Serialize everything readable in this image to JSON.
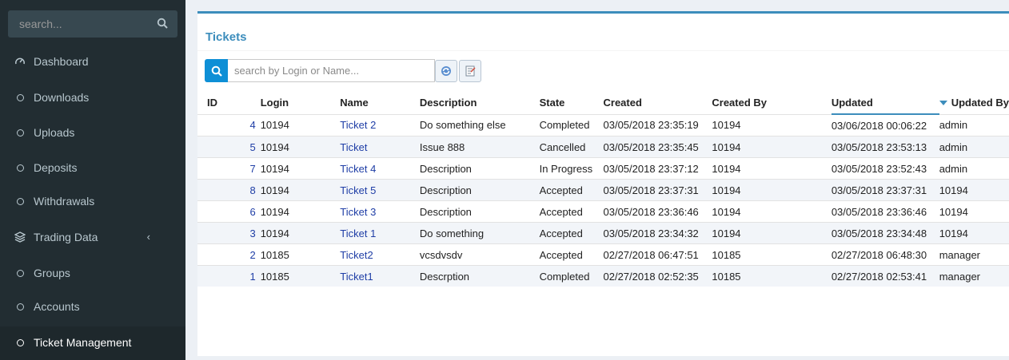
{
  "sidebar": {
    "search_placeholder": "search...",
    "items": [
      {
        "label": "Dashboard",
        "icon": "dashboard-icon"
      },
      {
        "label": "Downloads",
        "icon": "circle-icon"
      },
      {
        "label": "Uploads",
        "icon": "circle-icon"
      },
      {
        "label": "Deposits",
        "icon": "circle-icon"
      },
      {
        "label": "Withdrawals",
        "icon": "circle-icon"
      },
      {
        "label": "Trading Data",
        "icon": "layers-icon",
        "chevron": "‹"
      },
      {
        "label": "Groups",
        "icon": "circle-icon"
      },
      {
        "label": "Accounts",
        "icon": "circle-icon"
      },
      {
        "label": "Ticket Management",
        "icon": "circle-icon",
        "active": true
      }
    ]
  },
  "main": {
    "title": "Tickets",
    "search_placeholder": "search by Login or Name...",
    "columns": [
      "ID",
      "Login",
      "Name",
      "Description",
      "State",
      "Created",
      "Created By",
      "Updated",
      "Updated By"
    ],
    "sorted_column": "Updated",
    "rows": [
      {
        "id": "4",
        "login": "10194",
        "name": "Ticket 2",
        "description": "Do something else",
        "state": "Completed",
        "created": "03/05/2018 23:35:19",
        "created_by": "10194",
        "updated": "03/06/2018 00:06:22",
        "updated_by": "admin"
      },
      {
        "id": "5",
        "login": "10194",
        "name": "Ticket",
        "description": "Issue 888",
        "state": "Cancelled",
        "created": "03/05/2018 23:35:45",
        "created_by": "10194",
        "updated": "03/05/2018 23:53:13",
        "updated_by": "admin"
      },
      {
        "id": "7",
        "login": "10194",
        "name": "Ticket 4",
        "description": "Description",
        "state": "In Progress",
        "created": "03/05/2018 23:37:12",
        "created_by": "10194",
        "updated": "03/05/2018 23:52:43",
        "updated_by": "admin"
      },
      {
        "id": "8",
        "login": "10194",
        "name": "Ticket 5",
        "description": "Description",
        "state": "Accepted",
        "created": "03/05/2018 23:37:31",
        "created_by": "10194",
        "updated": "03/05/2018 23:37:31",
        "updated_by": "10194"
      },
      {
        "id": "6",
        "login": "10194",
        "name": "Ticket 3",
        "description": "Description",
        "state": "Accepted",
        "created": "03/05/2018 23:36:46",
        "created_by": "10194",
        "updated": "03/05/2018 23:36:46",
        "updated_by": "10194"
      },
      {
        "id": "3",
        "login": "10194",
        "name": "Ticket 1",
        "description": "Do something",
        "state": "Accepted",
        "created": "03/05/2018 23:34:32",
        "created_by": "10194",
        "updated": "03/05/2018 23:34:48",
        "updated_by": "10194"
      },
      {
        "id": "2",
        "login": "10185",
        "name": "Ticket2",
        "description": "vcsdvsdv",
        "state": "Accepted",
        "created": "02/27/2018 06:47:51",
        "created_by": "10185",
        "updated": "02/27/2018 06:48:30",
        "updated_by": "manager"
      },
      {
        "id": "1",
        "login": "10185",
        "name": "Ticket1",
        "description": "Descrption",
        "state": "Completed",
        "created": "02/27/2018 02:52:35",
        "created_by": "10185",
        "updated": "02/27/2018 02:53:41",
        "updated_by": "manager"
      }
    ]
  },
  "colors": {
    "sidebar_bg": "#222d32",
    "accent": "#3c8dbc",
    "link": "#1f3ea6",
    "search_button": "#0e8fd6"
  }
}
